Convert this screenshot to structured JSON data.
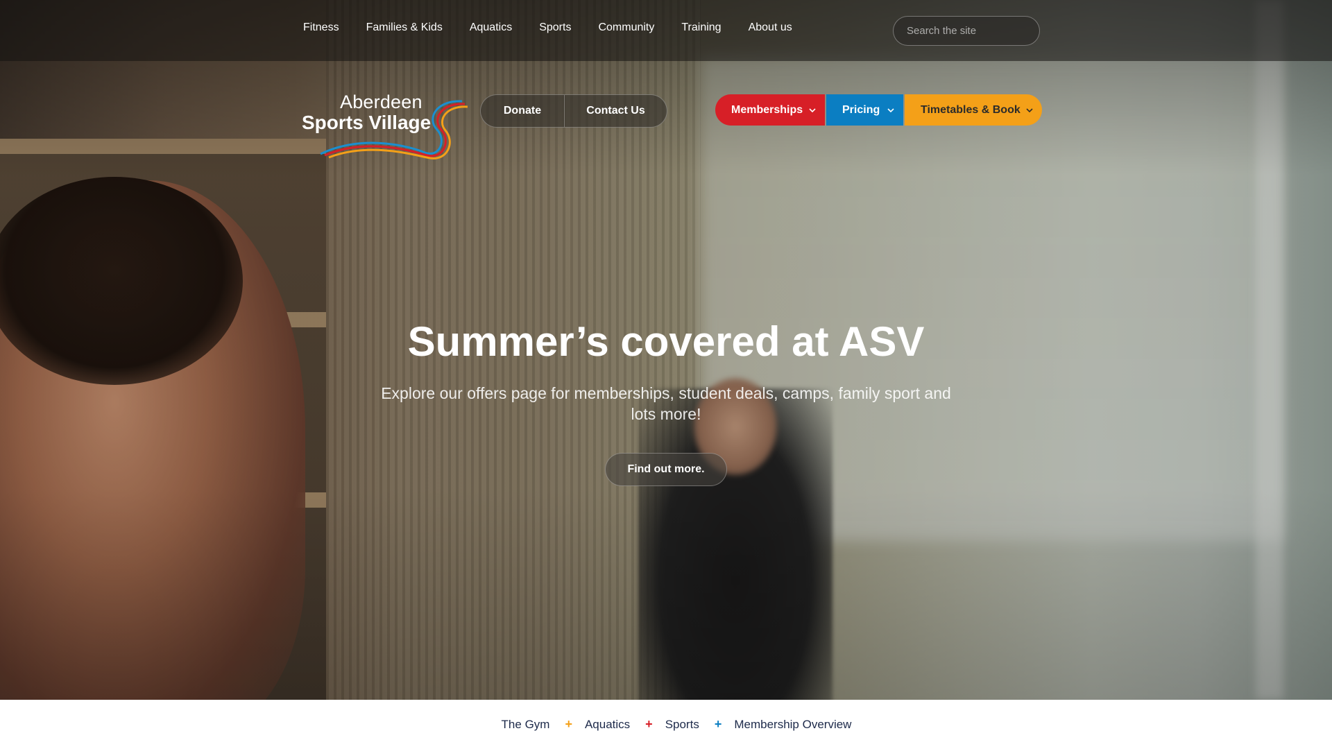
{
  "nav": {
    "items": [
      "Fitness",
      "Families & Kids",
      "Aquatics",
      "Sports",
      "Community",
      "Training",
      "About us"
    ]
  },
  "search": {
    "placeholder": "Search the site"
  },
  "logo": {
    "line1": "Aberdeen",
    "line2": "Sports Village"
  },
  "pills": {
    "donate": "Donate",
    "contact": "Contact Us"
  },
  "ctas": {
    "memberships": "Memberships",
    "pricing": "Pricing",
    "timetables": "Timetables & Book"
  },
  "hero": {
    "headline": "Summer’s covered at ASV",
    "subtext": "Explore our offers page for memberships, student deals, camps, family sport and lots more!",
    "button": "Find out more."
  },
  "quicklinks": {
    "items": [
      "The Gym",
      "Aquatics",
      "Sports",
      "Membership Overview"
    ],
    "plus": "+"
  },
  "colors": {
    "red": "#d71f27",
    "blue": "#0b7ec2",
    "orange": "#f4a018",
    "navy": "#1d2a4a"
  },
  "icons": [
    "search-icon",
    "chevron-down-icon",
    "plus-icon",
    "logo-swoosh-icon"
  ]
}
